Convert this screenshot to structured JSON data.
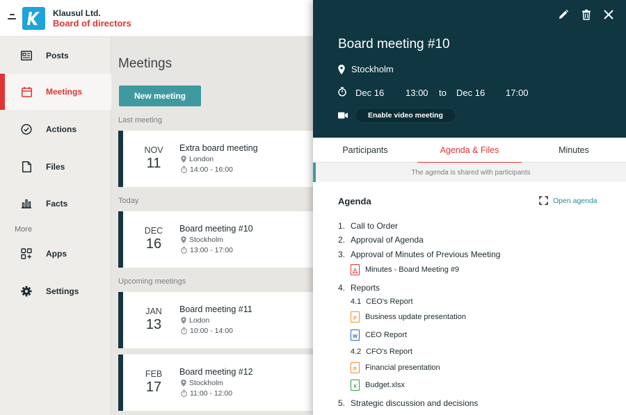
{
  "app": {
    "org_name": "Klausul Ltd.",
    "board_name": "Board of directors"
  },
  "sidebar": {
    "items": [
      {
        "label": "Posts",
        "icon": "posts-icon"
      },
      {
        "label": "Meetings",
        "icon": "calendar-icon",
        "active": true
      },
      {
        "label": "Actions",
        "icon": "check-circle-icon"
      },
      {
        "label": "Files",
        "icon": "file-icon"
      },
      {
        "label": "Facts",
        "icon": "bar-chart-icon"
      },
      {
        "label": "Apps",
        "icon": "apps-icon"
      },
      {
        "label": "Settings",
        "icon": "gear-icon"
      }
    ],
    "more_label": "More"
  },
  "meetings": {
    "title": "Meetings",
    "new_button": "New meeting",
    "sections": {
      "last": "Last meeting",
      "today": "Today",
      "upcoming": "Upcoming meetings"
    },
    "cards": [
      {
        "month": "NOV",
        "day": "11",
        "title": "Extra board meeting",
        "location": "London",
        "time": "14:00 - 16:00"
      },
      {
        "month": "DEC",
        "day": "16",
        "title": "Board meeting #10",
        "location": "Stockholm",
        "time": "13:00 - 17:00"
      },
      {
        "month": "JAN",
        "day": "13",
        "title": "Board meeting #11",
        "location": "Lodon",
        "time": "10:00 - 14:00"
      },
      {
        "month": "FEB",
        "day": "17",
        "title": "Board meeting #12",
        "location": "Stockholm",
        "time": "11:00 - 12:00"
      }
    ]
  },
  "detail": {
    "title": "Board meeting #10",
    "location": "Stockholm",
    "start_date": "Dec 16",
    "start_time": "13:00",
    "to_label": "to",
    "end_date": "Dec 16",
    "end_time": "17:00",
    "video_button": "Enable video meeting",
    "tabs": [
      "Participants",
      "Agenda & Files",
      "Minutes"
    ],
    "notice": "The agenda is shared with participants",
    "agenda_heading": "Agenda",
    "open_agenda": "Open agenda",
    "items": {
      "i1": {
        "num": "1.",
        "label": "Call to Order"
      },
      "i2": {
        "num": "2.",
        "label": "Approval of Agenda"
      },
      "i3": {
        "num": "3.",
        "label": "Approval of Minutes of Previous Meeting"
      },
      "f1": {
        "label": "Minutes - Board Meeting #9",
        "type": "pdf"
      },
      "i4": {
        "num": "4.",
        "label": "Reports"
      },
      "s41": {
        "num": "4.1",
        "label": "CEO's Report"
      },
      "f2": {
        "label": "Business update presentation",
        "type": "ppt"
      },
      "f3": {
        "label": "CEO Report",
        "type": "word"
      },
      "s42": {
        "num": "4.2",
        "label": "CFO's Report"
      },
      "f4": {
        "label": "Financial presentation",
        "type": "ppt"
      },
      "f5": {
        "label": "Budget.xlsx",
        "type": "excel"
      },
      "i5": {
        "num": "5.",
        "label": "Strategic discussion and decisions"
      }
    }
  },
  "colors": {
    "accent_red": "#e03434",
    "teal": "#3f9aa0",
    "header_dark": "#0f3641",
    "logo_blue": "#1ea3dc"
  }
}
